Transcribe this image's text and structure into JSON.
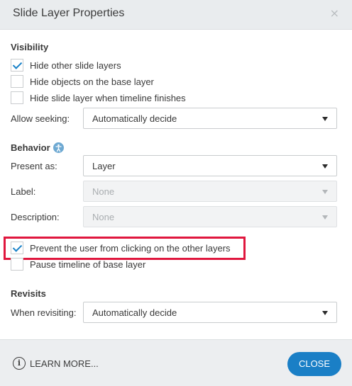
{
  "dialog": {
    "title": "Slide Layer Properties",
    "close_glyph": "×"
  },
  "visibility": {
    "heading": "Visibility",
    "options": [
      {
        "label": "Hide other slide layers",
        "checked": true
      },
      {
        "label": "Hide objects on the base layer",
        "checked": false
      },
      {
        "label": "Hide slide layer when timeline finishes",
        "checked": false
      }
    ],
    "seeking": {
      "label": "Allow seeking:",
      "value": "Automatically decide"
    }
  },
  "behavior": {
    "heading": "Behavior",
    "info_icon": "accessibility-info-icon",
    "present_as": {
      "label": "Present as:",
      "value": "Layer"
    },
    "label_field": {
      "label": "Label:",
      "value": "None",
      "disabled": true
    },
    "description_field": {
      "label": "Description:",
      "value": "None",
      "disabled": true
    },
    "prevent_click": {
      "label": "Prevent the user from clicking on the other layers",
      "checked": true
    },
    "pause_timeline": {
      "label": "Pause timeline of base layer",
      "checked": false
    }
  },
  "revisits": {
    "heading": "Revisits",
    "when_revisiting": {
      "label": "When revisiting:",
      "value": "Automatically decide"
    }
  },
  "footer": {
    "learn_more": "LEARN MORE...",
    "close": "CLOSE"
  },
  "colors": {
    "accent": "#1a7fc6",
    "highlight": "#e0173e"
  }
}
